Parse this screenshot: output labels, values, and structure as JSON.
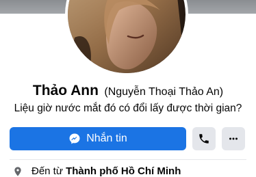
{
  "profile": {
    "display_name": "Thảo Ann",
    "alternate_name": "(Nguyễn Thoại Thảo An)",
    "bio": "Liệu giờ nước mắt đó có đổi lấy được thời gian?"
  },
  "actions": {
    "message_label": "Nhắn tin",
    "message_icon": "messenger-icon",
    "call_icon": "phone-icon",
    "more_icon": "more-icon",
    "accent_color": "#1b74e4"
  },
  "intro": {
    "location_prefix": "Đến từ",
    "location_place": "Thành phố Hồ Chí Minh",
    "location_icon": "location-pin-icon"
  }
}
